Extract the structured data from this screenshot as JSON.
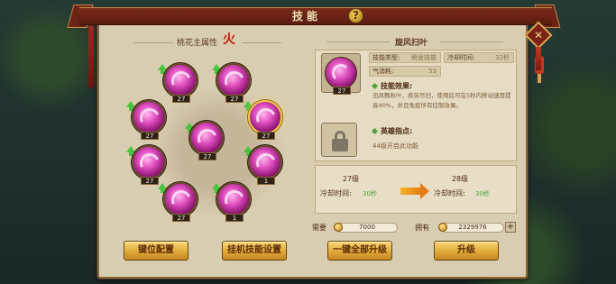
{
  "window": {
    "title": "技能",
    "help_label": "?",
    "close_label": "✕",
    "colors": {
      "panel": "#d9cdb1",
      "title_bar": "#7a2a1a",
      "accent_gold": "#e1a93a",
      "skill_pink": "#e04fc0",
      "green": "#46c53a"
    }
  },
  "left": {
    "attribute_label": "桃花主属性",
    "attribute_icon": "火",
    "skills": [
      {
        "level": "27",
        "upgradable": true,
        "selected": false,
        "icon": "pink-swirl-icon"
      },
      {
        "level": "27",
        "upgradable": true,
        "selected": false,
        "icon": "pink-swirl-icon"
      },
      {
        "level": "27",
        "upgradable": true,
        "selected": false,
        "icon": "pink-flower-icon"
      },
      {
        "level": "27",
        "upgradable": true,
        "selected": true,
        "icon": "pink-whirlwind-icon"
      },
      {
        "level": "27",
        "upgradable": true,
        "selected": false,
        "icon": "pink-burst-icon"
      },
      {
        "level": "27",
        "upgradable": true,
        "selected": false,
        "icon": "pink-aura-icon"
      },
      {
        "level": "1",
        "upgradable": true,
        "selected": false,
        "icon": "pink-note-icon"
      },
      {
        "level": "27",
        "upgradable": true,
        "selected": false,
        "icon": "pink-vortex-icon"
      },
      {
        "level": "1",
        "upgradable": true,
        "selected": false,
        "icon": "pink-spiral-icon"
      }
    ],
    "buttons": {
      "key_config": "键位配置",
      "auto_skill": "挂机技能设置"
    }
  },
  "right": {
    "skill_name": "旋风扫叶",
    "skill_level": "27",
    "type_label": "技能类型:",
    "type_value": "瞬发技能",
    "cooldown_label": "冷却时间:",
    "cooldown_value": "32秒",
    "qi_label": "气消耗:",
    "qi_value": "53",
    "effect_title": "技能效果:",
    "effect_desc": "迅风飘秋叶，疾突尽扫，使用后可在5秒内移动速度提高40%，并且免疫所有控制效果。",
    "hero_title": "英雄指点:",
    "hero_desc": "44级开启此功能",
    "upgrade": {
      "current_level": "27级",
      "next_level": "28级",
      "cd_label": "冷却时间:",
      "current_cd": "30秒",
      "next_cd": "30秒"
    },
    "cost": {
      "need_label": "需要",
      "need_value": "7000",
      "have_label": "拥有",
      "have_value": "2329976",
      "add_label": "+"
    },
    "buttons": {
      "upgrade_all": "一键全部升级",
      "upgrade": "升级"
    }
  }
}
